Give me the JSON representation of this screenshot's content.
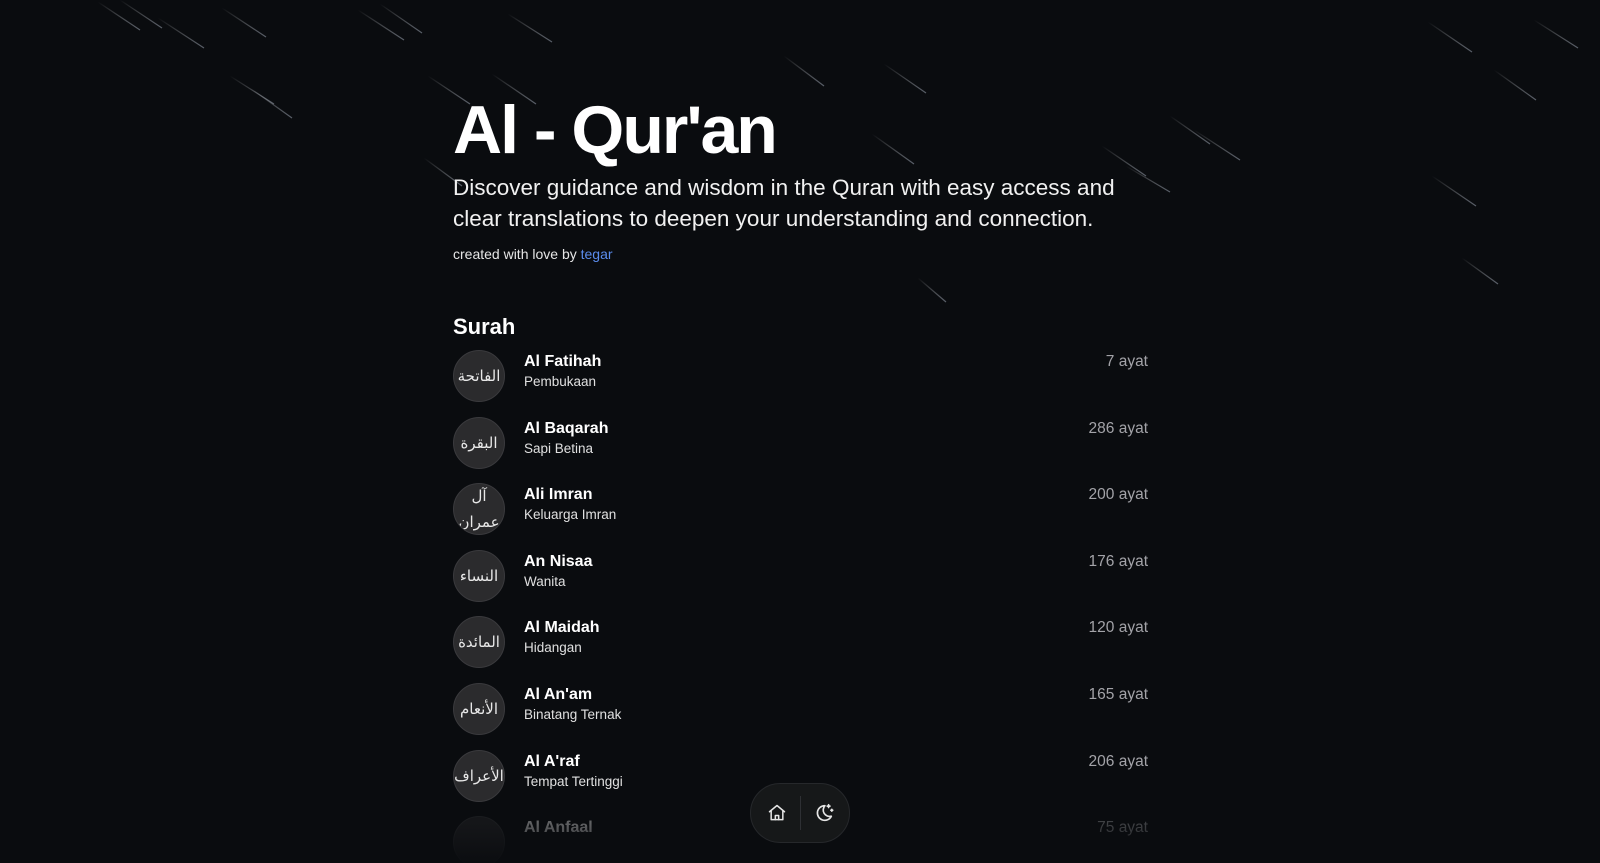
{
  "hero": {
    "title": "Al - Qur'an",
    "description": "Discover guidance and wisdom in the Quran with easy access and clear translations to deepen your understanding and connection.",
    "credit_prefix": "created with love by",
    "credit_author": "tegar"
  },
  "surah_section": {
    "title": "Surah",
    "items": [
      {
        "arabic": "الفاتحة",
        "name": "Al Fatihah",
        "meaning": "Pembukaan",
        "ayat": "7 ayat"
      },
      {
        "arabic": "البقرة",
        "name": "Al Baqarah",
        "meaning": "Sapi Betina",
        "ayat": "286 ayat"
      },
      {
        "arabic": "آل عمران",
        "name": "Ali Imran",
        "meaning": "Keluarga Imran",
        "ayat": "200 ayat"
      },
      {
        "arabic": "النساء",
        "name": "An Nisaa",
        "meaning": "Wanita",
        "ayat": "176 ayat"
      },
      {
        "arabic": "المائدة",
        "name": "Al Maidah",
        "meaning": "Hidangan",
        "ayat": "120 ayat"
      },
      {
        "arabic": "الأنعام",
        "name": "Al An'am",
        "meaning": "Binatang Ternak",
        "ayat": "165 ayat"
      },
      {
        "arabic": "الأعراف",
        "name": "Al A'raf",
        "meaning": "Tempat Tertinggi",
        "ayat": "206 ayat"
      },
      {
        "arabic": "",
        "name": "Al Anfaal",
        "meaning": "",
        "ayat": "75 ayat"
      }
    ]
  },
  "dock": {
    "home_icon": "home-icon",
    "theme_icon": "moon-stars-icon"
  },
  "colors": {
    "background": "#0a0c0f",
    "accent_link": "#5b8def",
    "muted_text": "#a3a3a8"
  }
}
